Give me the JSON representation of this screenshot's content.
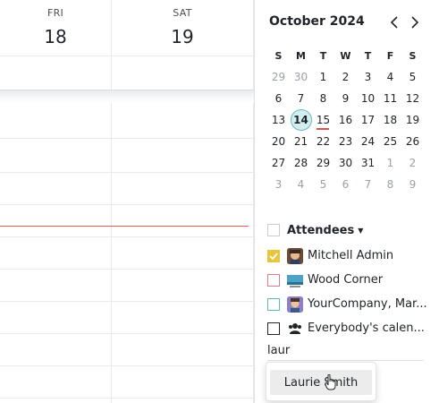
{
  "week": {
    "days": [
      {
        "name": "FRI",
        "number": "18"
      },
      {
        "name": "SAT",
        "number": "19"
      }
    ]
  },
  "mini_calendar": {
    "title": "October 2024",
    "prev_icon": "chevron-left-icon",
    "next_icon": "chevron-right-icon",
    "weekdays": [
      "S",
      "M",
      "T",
      "W",
      "T",
      "F",
      "S"
    ],
    "today": "14",
    "weeks": [
      [
        "29",
        "30",
        "1",
        "2",
        "3",
        "4",
        "5"
      ],
      [
        "6",
        "7",
        "8",
        "9",
        "10",
        "11",
        "12"
      ],
      [
        "13",
        "14",
        "15",
        "16",
        "17",
        "18",
        "19"
      ],
      [
        "20",
        "21",
        "22",
        "23",
        "24",
        "25",
        "26"
      ],
      [
        "27",
        "28",
        "29",
        "30",
        "31",
        "1",
        "2"
      ],
      [
        "3",
        "4",
        "5",
        "6",
        "7",
        "8",
        "9"
      ]
    ]
  },
  "attendees": {
    "title": "Attendees",
    "items": [
      {
        "label": "Mitchell Admin",
        "checked": true,
        "color": "#e8c53a",
        "icon": "avatar-mitchell"
      },
      {
        "label": "Wood Corner",
        "checked": false,
        "color": "#e07c8a",
        "icon": "avatar-wood-corner"
      },
      {
        "label": "YourCompany, Mar...",
        "checked": false,
        "color": "#5bc0a8",
        "icon": "avatar-yourcompany"
      },
      {
        "label": "Everybody's calen...",
        "checked": false,
        "color": "#212529",
        "icon": "users-icon"
      }
    ],
    "search_value": "laur",
    "suggestion": "Laurie Smith"
  },
  "colors": {
    "now_line": "#e35d5d",
    "today_bg": "#d3eeee",
    "checkbox_checked": "#e8c53a"
  }
}
